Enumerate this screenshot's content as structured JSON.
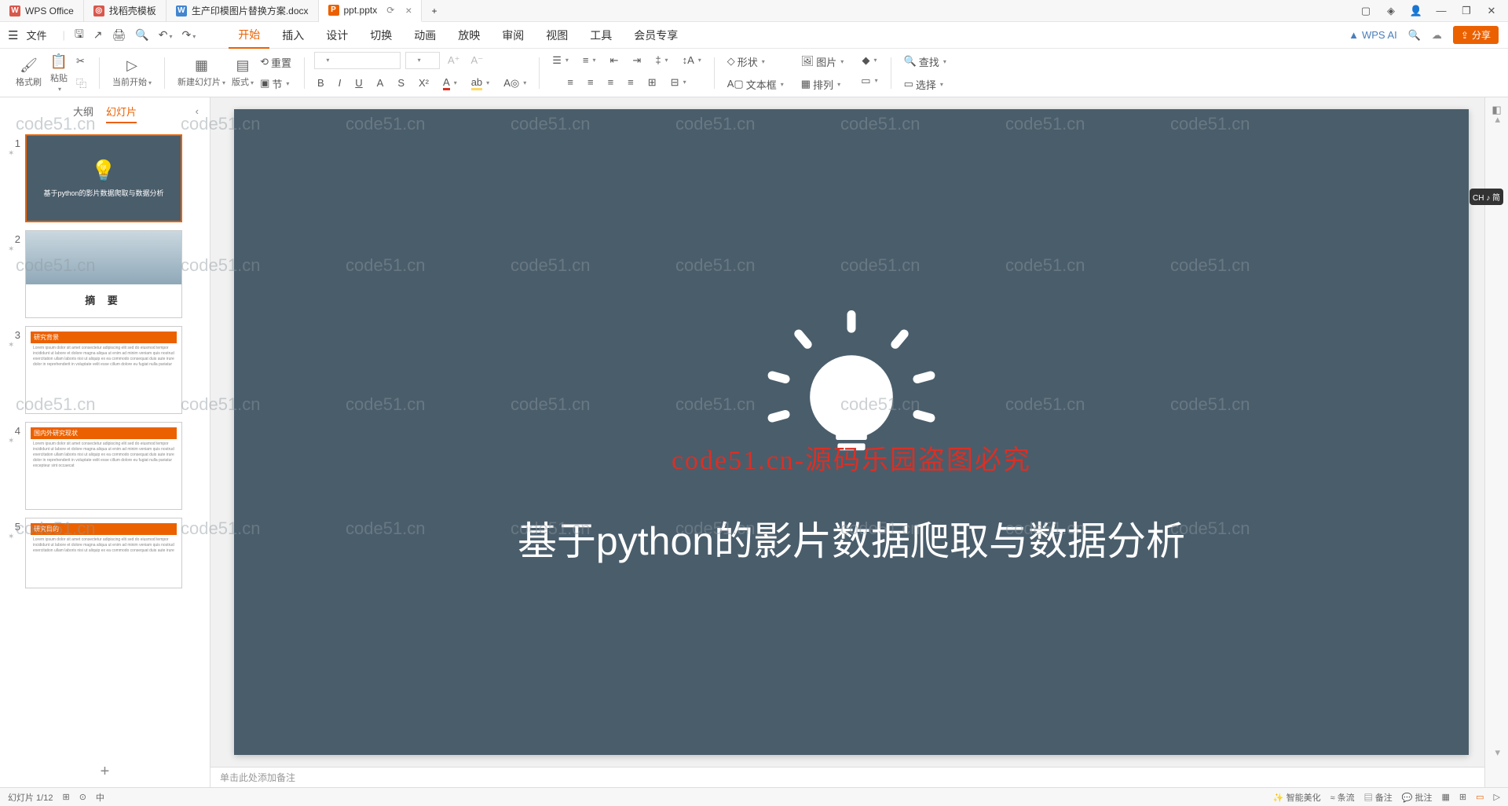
{
  "titlebar": {
    "tabs": [
      {
        "icon": "W",
        "label": "WPS Office"
      },
      {
        "icon": "🔍",
        "label": "找稻壳模板"
      },
      {
        "icon": "W",
        "label": "生产印模图片替换方案.docx"
      },
      {
        "icon": "P",
        "label": "ppt.pptx"
      }
    ],
    "newtab": "+"
  },
  "menubar": {
    "file": "文件",
    "tabs": [
      "开始",
      "插入",
      "设计",
      "切换",
      "动画",
      "放映",
      "审阅",
      "视图",
      "工具",
      "会员专享"
    ],
    "active": 0,
    "ai": "WPS AI",
    "share": "分享"
  },
  "ribbon": {
    "format_painter": "格式刷",
    "paste": "粘贴",
    "current_start": "当前开始",
    "new_slide": "新建幻灯片",
    "layout": "版式",
    "reset": "重置",
    "section": "节",
    "shape": "形状",
    "image": "图片",
    "textbox": "文本框",
    "arrange": "排列",
    "find": "查找",
    "select": "选择"
  },
  "sidebar": {
    "tabs": [
      "大纲",
      "幻灯片"
    ],
    "active": 1,
    "thumbs": [
      {
        "num": "1",
        "title": "基于python的影片数据爬取与数据分析"
      },
      {
        "num": "2",
        "title": "摘  要"
      },
      {
        "num": "3",
        "bar": "研究背景"
      },
      {
        "num": "4",
        "bar": "国内外研究现状"
      },
      {
        "num": "5",
        "bar": "研究目的"
      }
    ]
  },
  "slide": {
    "title": "基于python的影片数据爬取与数据分析",
    "overlay": "code51.cn-源码乐园盗图必究",
    "watermark": "code51.cn"
  },
  "notes": {
    "placeholder": "单击此处添加备注"
  },
  "rail": {
    "ime": "CH ♪ 简"
  },
  "status": {
    "left_items": [
      "幻灯片 1/12",
      "⊞",
      "⊙",
      "中"
    ],
    "right_items": [
      "智能美化",
      "条流",
      "备注",
      "批注"
    ]
  }
}
